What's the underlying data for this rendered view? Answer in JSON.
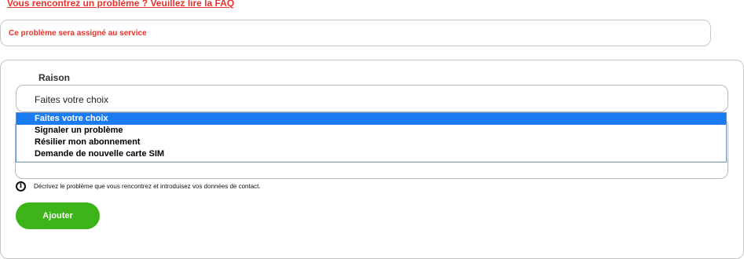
{
  "header": {
    "faq_link": "Vous rencontrez un problème ? Veuillez lire la FAQ"
  },
  "assignment": {
    "text": "Ce problème sera assigné au service"
  },
  "form": {
    "reason_label": "Raison",
    "reason_select": {
      "selected": "Faites votre choix",
      "options": [
        "Faites votre choix",
        "Signaler un problème",
        "Résilier mon abonnement",
        "Demande de nouvelle carte SIM"
      ]
    },
    "info_icon": "info-icon",
    "info_text": "Décrivez le problème que vous rencontrez et introduisez vos données de contact.",
    "submit_label": "Ajouter"
  },
  "colors": {
    "accent_red": "#e8322b",
    "button_green": "#3db51a",
    "selection_blue": "#1a7cf0"
  }
}
